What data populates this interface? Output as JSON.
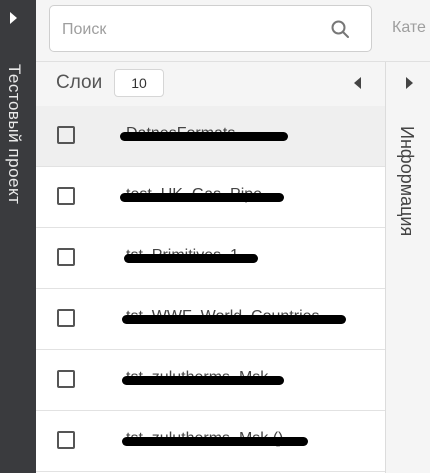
{
  "sidebar": {
    "project_title": "Тестовый проект"
  },
  "topbar": {
    "search_placeholder": "Поиск",
    "search_value": "",
    "category_label": "Кате"
  },
  "layers": {
    "title": "Слои",
    "count": "10",
    "items": [
      {
        "name": "DatnesFormats",
        "checked": false,
        "active": true
      },
      {
        "name": "test_UK_Gas_Pipe",
        "checked": false,
        "active": false
      },
      {
        "name": "tst_Primitives_1",
        "checked": false,
        "active": false
      },
      {
        "name": "tst_WWF_World_Countries",
        "checked": false,
        "active": false
      },
      {
        "name": "tst_zulutherms_Msk",
        "checked": false,
        "active": false
      },
      {
        "name": "tst_zulutherms_Msk ()",
        "checked": false,
        "active": false
      }
    ]
  },
  "info_panel": {
    "label": "Информация"
  },
  "colors": {
    "sidebar_bg": "#3a3b3e",
    "panel_bg": "#f5f5f5",
    "active_row_bg": "#efefef"
  }
}
